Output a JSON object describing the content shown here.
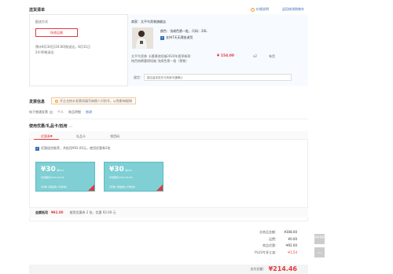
{
  "delivery": {
    "title": "送货清单",
    "price_notice": "价格说明",
    "back_to_cart": "返回修改购物车",
    "shipping_label": "配送方式",
    "shipping_option": "快递运输",
    "shipping_note_1": "预计8月30日[24:00]前送达，8月31日",
    "shipping_note_2": "24:00前送达",
    "merchant": "商家：太平鸟男装旗舰店",
    "product_color": "颜色：浅咸色第一批，尺码：2XL",
    "product_service": "支持7天无理由退货",
    "product_desc_1": "太平鸟男装 卡通潮流短袖2024年夏季新款",
    "product_desc_2": "纯色纯棉重磅短袖 浅咸色第一批（预售）",
    "product_price": "¥ 154.00",
    "product_qty": "x2",
    "product_stock": "有货",
    "remark_label": "留言：",
    "remark_placeholder": "建议留言前先与商家沟通确认"
  },
  "invoice": {
    "title": "发票信息",
    "notice": "开企业抬头发票须填写纳税人识别号，以免影响报销",
    "type": "电子普通发票",
    "personal": "个人",
    "content": "商品明细",
    "edit": "修改"
  },
  "coupons": {
    "title": "使用优惠/礼品卡/抵用",
    "tabs": [
      "优惠券",
      "礼品卡",
      "领货码"
    ],
    "checkbox_text": "优惠组合推荐，共抵用¥92.00元，使用优惠券2张",
    "cards": [
      {
        "amount": "¥30",
        "cond": "满XXX",
        "expiry": "有效期至2024-09-09",
        "tags": "[东券]  [限品类]  [可叠加]"
      },
      {
        "amount": "¥30",
        "cond": "满XXX",
        "expiry": "有效期至2024-09-09",
        "tags": "[东券]  [限品类]  [可叠加]"
      }
    ],
    "summary_label": "金额抵用",
    "summary_amount": "¥92.00",
    "summary_text": "使用优惠券 2 张，优惠 92.00 元"
  },
  "totals": {
    "rows": [
      {
        "label": "总商品金额：",
        "value": "¥308.00"
      },
      {
        "label": "运费：",
        "value": "¥0.00"
      },
      {
        "label": "商品优惠：",
        "value": "-¥92.00"
      },
      {
        "label": "PLUS专享立减：",
        "value": "-¥1.54"
      }
    ],
    "payable_label": "应付总额：",
    "payable_value": "¥214.46"
  },
  "side": {
    "service": "联系客服",
    "top": "︿"
  }
}
